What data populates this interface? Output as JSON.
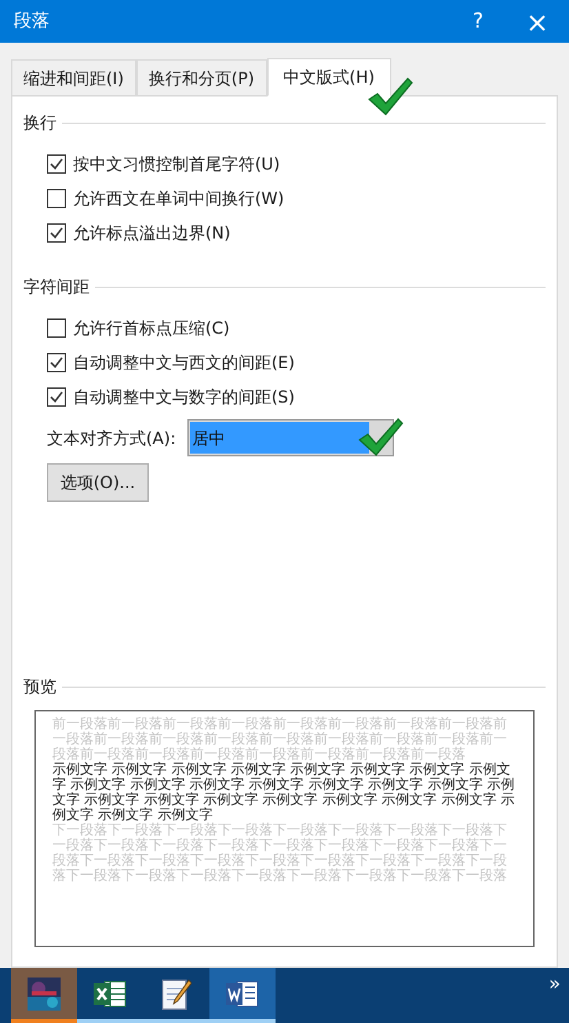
{
  "window": {
    "title": "段落",
    "help": "?",
    "close": "×"
  },
  "tabs": [
    {
      "label": "缩进和间距(I)",
      "selected": false
    },
    {
      "label": "换行和分页(P)",
      "selected": false
    },
    {
      "label": "中文版式(H)",
      "selected": true
    }
  ],
  "sections": [
    {
      "title": "换行",
      "options": [
        {
          "label": "按中文习惯控制首尾字符(U)",
          "checked": true
        },
        {
          "label": "允许西文在单词中间换行(W)",
          "checked": false
        },
        {
          "label": "允许标点溢出边界(N)",
          "checked": true
        }
      ]
    },
    {
      "title": "字符间距",
      "options": [
        {
          "label": "允许行首标点压缩(C)",
          "checked": false
        },
        {
          "label": "自动调整中文与西文的间距(E)",
          "checked": true
        },
        {
          "label": "自动调整中文与数字的间距(S)",
          "checked": true
        }
      ]
    }
  ],
  "alignment": {
    "label": "文本对齐方式(A):",
    "value": "居中"
  },
  "options_button": "选项(O)...",
  "preview": {
    "title": "预览",
    "previous_text": "前一段落前一段落前一段落前一段落前一段落前一段落前一段落前一段落前一段落前一段落前一段落前一段落前一段落前一段落前一段落前一段落前一段落前一段落前一段落前一段落前一段落前一段落前一段落前一段落",
    "sample_text": "示例文字 示例文字 示例文字 示例文字 示例文字 示例文字 示例文字 示例文字 示例文字 示例文字 示例文字 示例文字 示例文字 示例文字 示例文字 示例文字 示例文字 示例文字 示例文字 示例文字 示例文字 示例文字 示例文字 示例文字 示例文字 示例文字",
    "next_text": "下一段落下一段落下一段落下一段落下一段落下一段落下一段落下一段落下一段落下一段落下一段落下一段落下一段落下一段落下一段落下一段落下一段落下一段落下一段落下一段落下一段落下一段落下一段落下一段落下一段落下一段落下一段落下一段落下一段落下一段落下一段落下一段落下一段落"
  },
  "taskbar": {
    "items": [
      {
        "kind": "picture",
        "selected": true,
        "focused": false
      },
      {
        "kind": "excel",
        "selected": false,
        "focused": false
      },
      {
        "kind": "notepad",
        "selected": false,
        "focused": false
      },
      {
        "kind": "word",
        "selected": false,
        "focused": true
      }
    ],
    "overflow": "»"
  }
}
